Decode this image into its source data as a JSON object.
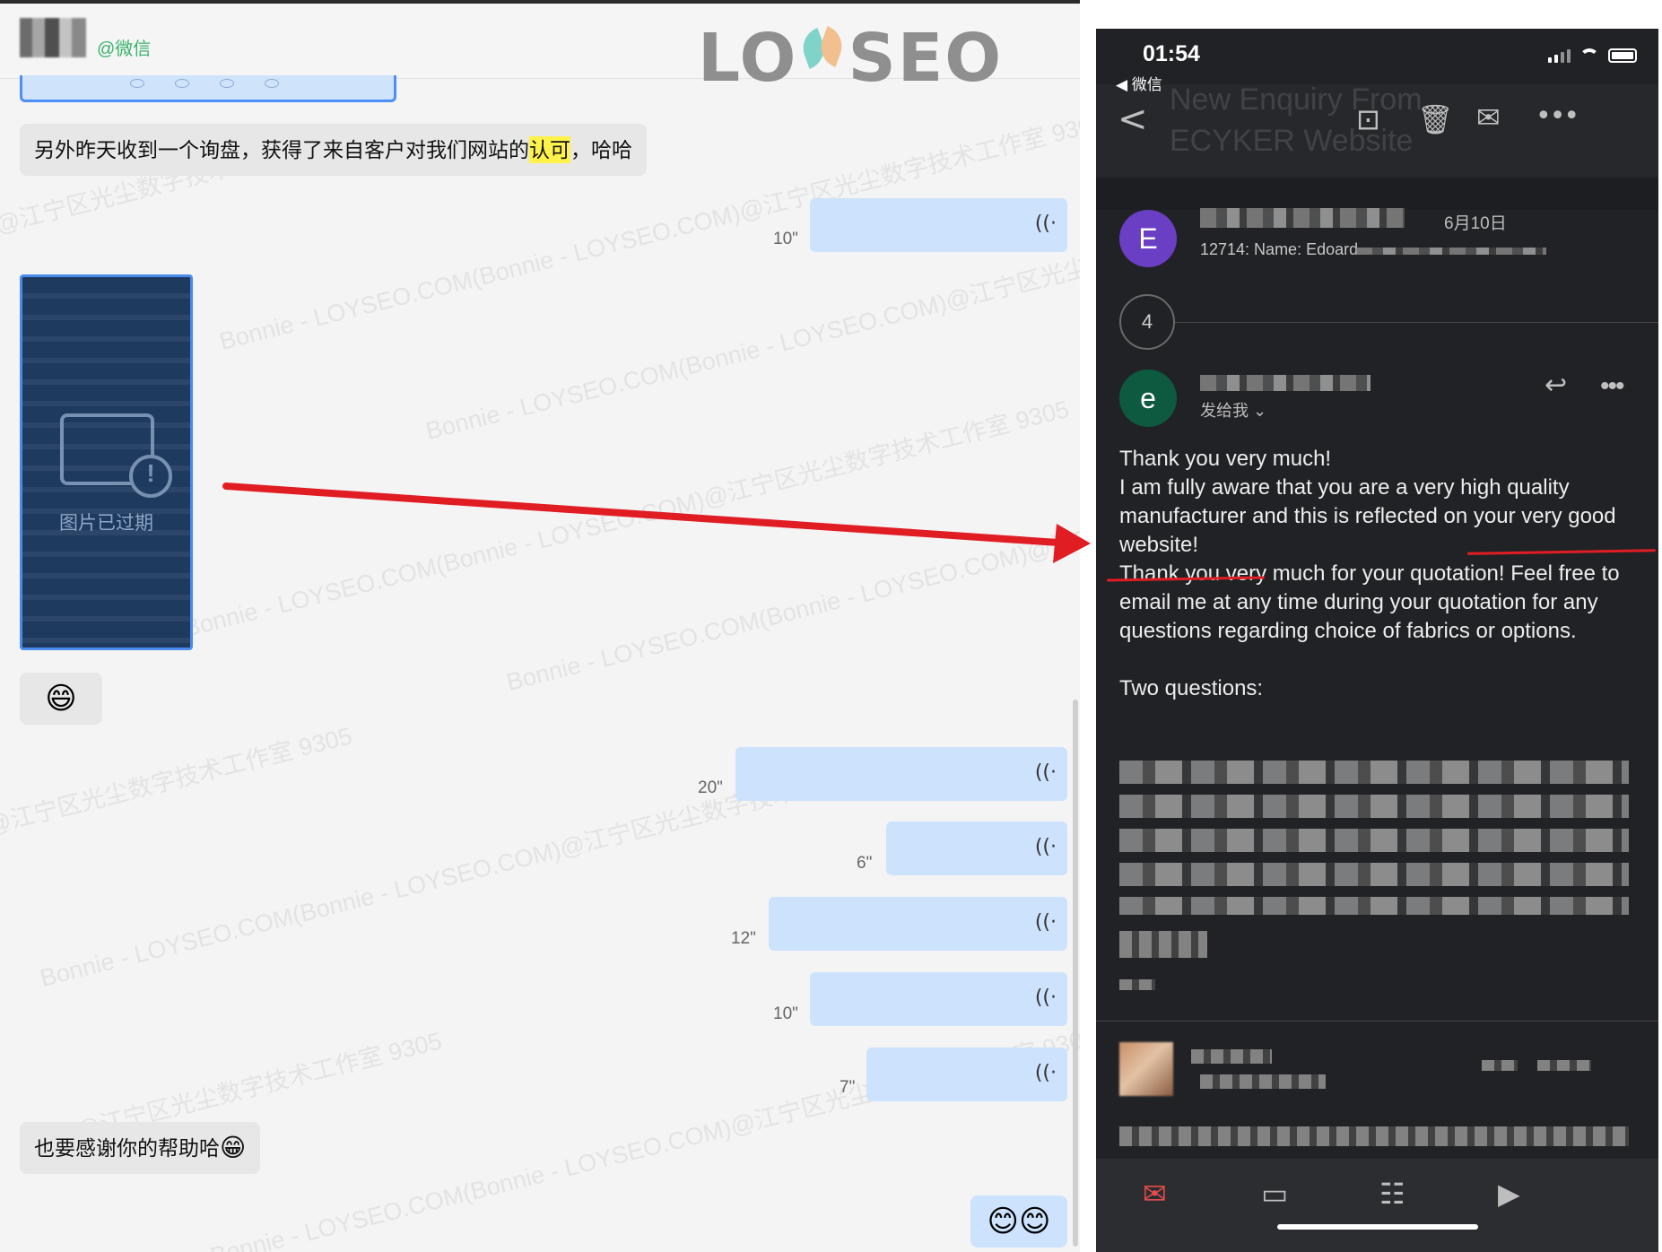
{
  "chat": {
    "source_label": "@微信",
    "logo": "LOYSEO",
    "messages": {
      "inquiry_text_before": "另外昨天收到一个询盘，获得了来自客户对我们网站的",
      "inquiry_highlight": "认可",
      "inquiry_text_after": "，哈哈",
      "expired_image_caption": "图片已过期",
      "emoji_grin": "😄",
      "thanks_text": "也要感谢你的帮助哈",
      "thanks_emoji": "😁",
      "final_emoji": "😊😊"
    },
    "voice_messages": [
      {
        "duration": "10\""
      },
      {
        "duration": "20\""
      },
      {
        "duration": "6\""
      },
      {
        "duration": "12\""
      },
      {
        "duration": "10\""
      },
      {
        "duration": "7\""
      }
    ],
    "voice_icon": "((·",
    "watermarks": {
      "a": "Bonnie - LOYSEO.COM(Bonnie - LOYSEO.COM)@江宁区光尘数字技术工作室 9305",
      "b": "@江宁区光尘数字技术工作室 9305"
    }
  },
  "phone": {
    "status": {
      "time": "01:54",
      "back_label": "◀ 微信"
    },
    "subject_ghost": "New Enquiry From ECYKER Website",
    "email1": {
      "avatar_letter": "E",
      "date": "6月10日",
      "snippet": "12714: Name: Edoard"
    },
    "thread_count": "4",
    "email2": {
      "avatar_letter": "e",
      "to_label": "发给我 ⌄"
    },
    "body": {
      "line1": "Thank you very much!",
      "line2": "I am fully aware that you are a very high quality manufacturer and this is reflected on your very good website!",
      "line3": "Thank you very much for your quotation! Feel free to email me at any time during your quotation for any questions regarding choice of fabrics or options.",
      "line4": "Two questions:"
    },
    "icons": {
      "back": "<",
      "archive": "⊡",
      "delete": "🗑",
      "mark_unread": "✉",
      "more": "•••",
      "reply": "↩",
      "tab_mail": "✉",
      "tab_chat": "▭",
      "tab_people": "☷",
      "tab_video": "▶"
    }
  },
  "colors": {
    "accent_red": "#e11d24",
    "voice_bubble": "#cde2fd",
    "highlight": "#fff24a",
    "avatar_e1": "#6a3fc4",
    "avatar_e2": "#0d5a40"
  }
}
